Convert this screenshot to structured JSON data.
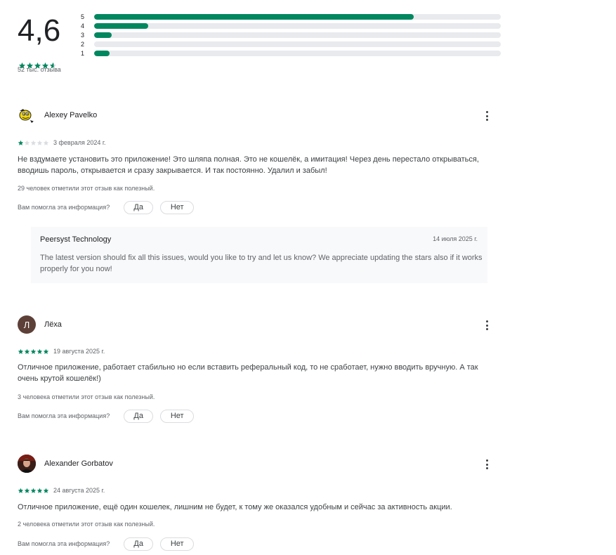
{
  "summary": {
    "score": "4,6",
    "stars": [
      1,
      1,
      1,
      1,
      0.6
    ],
    "reviews_count": "52 тыс. отзыва",
    "distribution": [
      {
        "label": "5",
        "fraction": 0.785
      },
      {
        "label": "4",
        "fraction": 0.133
      },
      {
        "label": "3",
        "fraction": 0.043
      },
      {
        "label": "2",
        "fraction": 0.0
      },
      {
        "label": "1",
        "fraction": 0.038
      }
    ]
  },
  "colors": {
    "accent": "#01875f",
    "track": "#e8eaed",
    "star_empty": "#dadce0"
  },
  "reviews": [
    {
      "author": "Alexey Pavelko",
      "avatar_icon": "cartoon-face-avatar",
      "rating": 1,
      "date": "3 февраля 2024 г.",
      "text": "Не вздумаете установить это приложение! Это шляпа полная. Это не кошелёк, а имитация! Через день перестало открываться, вводишь пароль, открывается и сразу закрывается. И так постоянно. Удалил и забыл!",
      "helpful": "29 человек отметили этот отзыв как полезный.",
      "ask": "Вам помогла эта информация?",
      "yes": "Да",
      "no": "Нет",
      "reply": {
        "author": "Peersyst Technology",
        "date": "14 июля 2025 г.",
        "text": "The latest version should fix all this issues, would you like to try and let us know? We appreciate updating the stars also if it works properly for you now!"
      }
    },
    {
      "author": "Лёха",
      "avatar_letter": "Л",
      "avatar_color": "#5d4037",
      "rating": 5,
      "date": "19 августа 2025 г.",
      "text": "Отличное приложение, работает стабильно но если вставить реферальный код, то не сработает, нужно вводить вручную. А так очень крутой кошелёк!)",
      "helpful": "3 человека отметили этот отзыв как полезный.",
      "ask": "Вам помогла эта информация?",
      "yes": "Да",
      "no": "Нет"
    },
    {
      "author": "Alexander Gorbatov",
      "avatar_icon": "photo-avatar",
      "rating": 5,
      "date": "24 августа 2025 г.",
      "text": "Отличное приложение, ещё один кошелек, лишним не будет, к тому же оказался удобным и сейчас за активность акции.",
      "helpful": "2 человека отметили этот отзыв как полезный.",
      "ask": "Вам помогла эта информация?",
      "yes": "Да",
      "no": "Нет"
    }
  ]
}
